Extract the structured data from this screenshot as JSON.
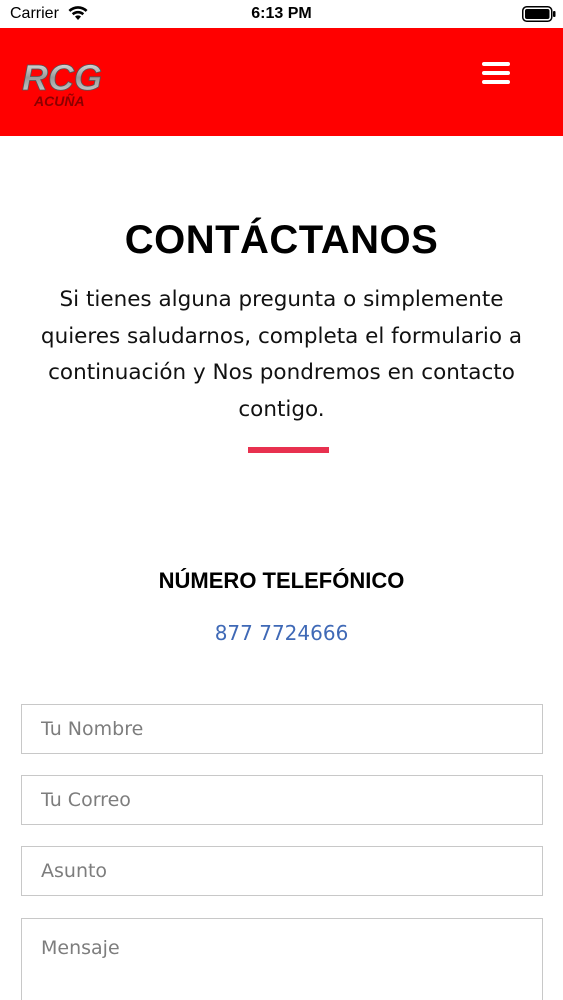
{
  "status_bar": {
    "carrier": "Carrier",
    "time": "6:13 PM",
    "icons": [
      "wifi-icon",
      "battery-icon"
    ]
  },
  "header": {
    "background_color": "#ff0000",
    "logo_text_main": "RCG",
    "logo_text_sub": "ACUÑA",
    "menu_icon": "hamburger-menu-icon"
  },
  "content": {
    "title": "CONTÁCTANOS",
    "intro": "Si tienes alguna pregunta o simplemente quieres saludarnos, completa el formulario a continuación y Nos pondremos en contacto contigo.",
    "divider_color": "#e8314f",
    "phone_heading": "NÚMERO TELEFÓNICO",
    "phone_number": "877 7724666",
    "link_color": "#3f69b6"
  },
  "form": {
    "name_placeholder": "Tu Nombre",
    "email_placeholder": "Tu Correo",
    "subject_placeholder": "Asunto",
    "message_placeholder": "Mensaje"
  }
}
